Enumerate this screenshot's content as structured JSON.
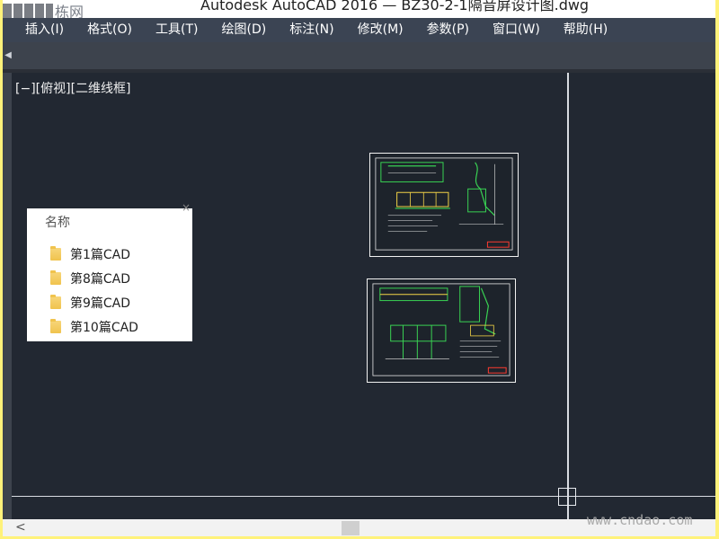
{
  "window": {
    "title": "Autodesk AutoCAD 2016 — BZ30-2-1隔音屏设计图.dwg",
    "logo_text": "栋网"
  },
  "menubar": {
    "items": [
      "插入(I)",
      "格式(O)",
      "工具(T)",
      "绘图(D)",
      "标注(N)",
      "修改(M)",
      "参数(P)",
      "窗口(W)",
      "帮助(H)"
    ]
  },
  "viewport": {
    "label": "[−][俯视][二维线框]"
  },
  "file_panel": {
    "header": "名称",
    "close_glyph": "×",
    "folders": [
      "第1篇CAD",
      "第8篇CAD",
      "第9篇CAD",
      "第10篇CAD"
    ]
  },
  "scrollbar": {
    "left_arrow": "<"
  },
  "watermark": "www.cndao.com",
  "colors": {
    "viewport_bg": "#222832",
    "menubar_bg": "#3b4453",
    "drawing_green": "#39d353",
    "drawing_red": "#ff3b30",
    "outer_border": "#fff27a"
  }
}
